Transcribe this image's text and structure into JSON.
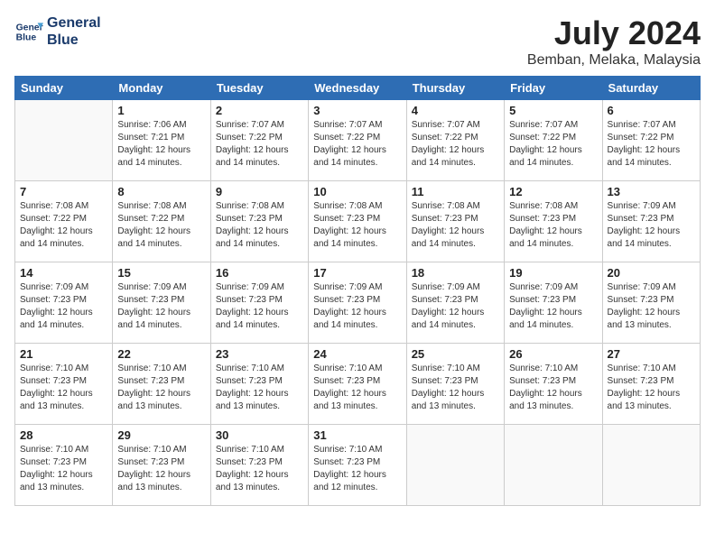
{
  "logo": {
    "line1": "General",
    "line2": "Blue"
  },
  "title": "July 2024",
  "location": "Bemban, Melaka, Malaysia",
  "days_of_week": [
    "Sunday",
    "Monday",
    "Tuesday",
    "Wednesday",
    "Thursday",
    "Friday",
    "Saturday"
  ],
  "weeks": [
    [
      {
        "day": "",
        "sunrise": "",
        "sunset": "",
        "daylight": ""
      },
      {
        "day": "1",
        "sunrise": "Sunrise: 7:06 AM",
        "sunset": "Sunset: 7:21 PM",
        "daylight": "Daylight: 12 hours and 14 minutes."
      },
      {
        "day": "2",
        "sunrise": "Sunrise: 7:07 AM",
        "sunset": "Sunset: 7:22 PM",
        "daylight": "Daylight: 12 hours and 14 minutes."
      },
      {
        "day": "3",
        "sunrise": "Sunrise: 7:07 AM",
        "sunset": "Sunset: 7:22 PM",
        "daylight": "Daylight: 12 hours and 14 minutes."
      },
      {
        "day": "4",
        "sunrise": "Sunrise: 7:07 AM",
        "sunset": "Sunset: 7:22 PM",
        "daylight": "Daylight: 12 hours and 14 minutes."
      },
      {
        "day": "5",
        "sunrise": "Sunrise: 7:07 AM",
        "sunset": "Sunset: 7:22 PM",
        "daylight": "Daylight: 12 hours and 14 minutes."
      },
      {
        "day": "6",
        "sunrise": "Sunrise: 7:07 AM",
        "sunset": "Sunset: 7:22 PM",
        "daylight": "Daylight: 12 hours and 14 minutes."
      }
    ],
    [
      {
        "day": "7",
        "sunrise": "Sunrise: 7:08 AM",
        "sunset": "Sunset: 7:22 PM",
        "daylight": "Daylight: 12 hours and 14 minutes."
      },
      {
        "day": "8",
        "sunrise": "Sunrise: 7:08 AM",
        "sunset": "Sunset: 7:22 PM",
        "daylight": "Daylight: 12 hours and 14 minutes."
      },
      {
        "day": "9",
        "sunrise": "Sunrise: 7:08 AM",
        "sunset": "Sunset: 7:23 PM",
        "daylight": "Daylight: 12 hours and 14 minutes."
      },
      {
        "day": "10",
        "sunrise": "Sunrise: 7:08 AM",
        "sunset": "Sunset: 7:23 PM",
        "daylight": "Daylight: 12 hours and 14 minutes."
      },
      {
        "day": "11",
        "sunrise": "Sunrise: 7:08 AM",
        "sunset": "Sunset: 7:23 PM",
        "daylight": "Daylight: 12 hours and 14 minutes."
      },
      {
        "day": "12",
        "sunrise": "Sunrise: 7:08 AM",
        "sunset": "Sunset: 7:23 PM",
        "daylight": "Daylight: 12 hours and 14 minutes."
      },
      {
        "day": "13",
        "sunrise": "Sunrise: 7:09 AM",
        "sunset": "Sunset: 7:23 PM",
        "daylight": "Daylight: 12 hours and 14 minutes."
      }
    ],
    [
      {
        "day": "14",
        "sunrise": "Sunrise: 7:09 AM",
        "sunset": "Sunset: 7:23 PM",
        "daylight": "Daylight: 12 hours and 14 minutes."
      },
      {
        "day": "15",
        "sunrise": "Sunrise: 7:09 AM",
        "sunset": "Sunset: 7:23 PM",
        "daylight": "Daylight: 12 hours and 14 minutes."
      },
      {
        "day": "16",
        "sunrise": "Sunrise: 7:09 AM",
        "sunset": "Sunset: 7:23 PM",
        "daylight": "Daylight: 12 hours and 14 minutes."
      },
      {
        "day": "17",
        "sunrise": "Sunrise: 7:09 AM",
        "sunset": "Sunset: 7:23 PM",
        "daylight": "Daylight: 12 hours and 14 minutes."
      },
      {
        "day": "18",
        "sunrise": "Sunrise: 7:09 AM",
        "sunset": "Sunset: 7:23 PM",
        "daylight": "Daylight: 12 hours and 14 minutes."
      },
      {
        "day": "19",
        "sunrise": "Sunrise: 7:09 AM",
        "sunset": "Sunset: 7:23 PM",
        "daylight": "Daylight: 12 hours and 14 minutes."
      },
      {
        "day": "20",
        "sunrise": "Sunrise: 7:09 AM",
        "sunset": "Sunset: 7:23 PM",
        "daylight": "Daylight: 12 hours and 13 minutes."
      }
    ],
    [
      {
        "day": "21",
        "sunrise": "Sunrise: 7:10 AM",
        "sunset": "Sunset: 7:23 PM",
        "daylight": "Daylight: 12 hours and 13 minutes."
      },
      {
        "day": "22",
        "sunrise": "Sunrise: 7:10 AM",
        "sunset": "Sunset: 7:23 PM",
        "daylight": "Daylight: 12 hours and 13 minutes."
      },
      {
        "day": "23",
        "sunrise": "Sunrise: 7:10 AM",
        "sunset": "Sunset: 7:23 PM",
        "daylight": "Daylight: 12 hours and 13 minutes."
      },
      {
        "day": "24",
        "sunrise": "Sunrise: 7:10 AM",
        "sunset": "Sunset: 7:23 PM",
        "daylight": "Daylight: 12 hours and 13 minutes."
      },
      {
        "day": "25",
        "sunrise": "Sunrise: 7:10 AM",
        "sunset": "Sunset: 7:23 PM",
        "daylight": "Daylight: 12 hours and 13 minutes."
      },
      {
        "day": "26",
        "sunrise": "Sunrise: 7:10 AM",
        "sunset": "Sunset: 7:23 PM",
        "daylight": "Daylight: 12 hours and 13 minutes."
      },
      {
        "day": "27",
        "sunrise": "Sunrise: 7:10 AM",
        "sunset": "Sunset: 7:23 PM",
        "daylight": "Daylight: 12 hours and 13 minutes."
      }
    ],
    [
      {
        "day": "28",
        "sunrise": "Sunrise: 7:10 AM",
        "sunset": "Sunset: 7:23 PM",
        "daylight": "Daylight: 12 hours and 13 minutes."
      },
      {
        "day": "29",
        "sunrise": "Sunrise: 7:10 AM",
        "sunset": "Sunset: 7:23 PM",
        "daylight": "Daylight: 12 hours and 13 minutes."
      },
      {
        "day": "30",
        "sunrise": "Sunrise: 7:10 AM",
        "sunset": "Sunset: 7:23 PM",
        "daylight": "Daylight: 12 hours and 13 minutes."
      },
      {
        "day": "31",
        "sunrise": "Sunrise: 7:10 AM",
        "sunset": "Sunset: 7:23 PM",
        "daylight": "Daylight: 12 hours and 12 minutes."
      },
      {
        "day": "",
        "sunrise": "",
        "sunset": "",
        "daylight": ""
      },
      {
        "day": "",
        "sunrise": "",
        "sunset": "",
        "daylight": ""
      },
      {
        "day": "",
        "sunrise": "",
        "sunset": "",
        "daylight": ""
      }
    ]
  ]
}
